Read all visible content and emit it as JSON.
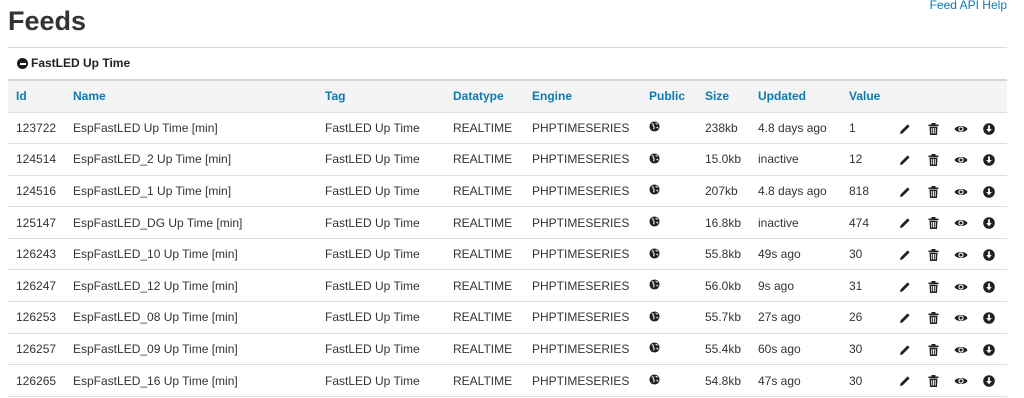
{
  "page": {
    "title": "Feeds",
    "api_help_link": "Feed API Help"
  },
  "group": {
    "title": "FastLED Up Time",
    "collapse_icon": "minus-circle-icon"
  },
  "table": {
    "columns": [
      "Id",
      "Name",
      "Tag",
      "Datatype",
      "Engine",
      "Public",
      "Size",
      "Updated",
      "Value"
    ],
    "action_icons": [
      "pencil-icon",
      "trash-icon",
      "eye-icon",
      "download-icon"
    ],
    "public_icon": "globe-icon",
    "status_colors": {
      "red": "#e52222",
      "orange": "#f0a020",
      "green": "#39a839"
    },
    "rows": [
      {
        "id": "123722",
        "name": "EspFastLED Up Time [min]",
        "tag": "FastLED Up Time",
        "datatype": "REALTIME",
        "engine": "PHPTIMESERIES",
        "size": "238kb",
        "updated": "4.8 days ago",
        "status": "red",
        "value": "1"
      },
      {
        "id": "124514",
        "name": "EspFastLED_2 Up Time [min]",
        "tag": "FastLED Up Time",
        "datatype": "REALTIME",
        "engine": "PHPTIMESERIES",
        "size": "15.0kb",
        "updated": "inactive",
        "status": "red",
        "value": "12"
      },
      {
        "id": "124516",
        "name": "EspFastLED_1 Up Time [min]",
        "tag": "FastLED Up Time",
        "datatype": "REALTIME",
        "engine": "PHPTIMESERIES",
        "size": "207kb",
        "updated": "4.8 days ago",
        "status": "red",
        "value": "818"
      },
      {
        "id": "125147",
        "name": "EspFastLED_DG Up Time [min]",
        "tag": "FastLED Up Time",
        "datatype": "REALTIME",
        "engine": "PHPTIMESERIES",
        "size": "16.8kb",
        "updated": "inactive",
        "status": "red",
        "value": "474"
      },
      {
        "id": "126243",
        "name": "EspFastLED_10 Up Time [min]",
        "tag": "FastLED Up Time",
        "datatype": "REALTIME",
        "engine": "PHPTIMESERIES",
        "size": "55.8kb",
        "updated": "49s ago",
        "status": "orange",
        "value": "30"
      },
      {
        "id": "126247",
        "name": "EspFastLED_12 Up Time [min]",
        "tag": "FastLED Up Time",
        "datatype": "REALTIME",
        "engine": "PHPTIMESERIES",
        "size": "56.0kb",
        "updated": "9s ago",
        "status": "green",
        "value": "31"
      },
      {
        "id": "126253",
        "name": "EspFastLED_08 Up Time [min]",
        "tag": "FastLED Up Time",
        "datatype": "REALTIME",
        "engine": "PHPTIMESERIES",
        "size": "55.7kb",
        "updated": "27s ago",
        "status": "orange",
        "value": "26"
      },
      {
        "id": "126257",
        "name": "EspFastLED_09 Up Time [min]",
        "tag": "FastLED Up Time",
        "datatype": "REALTIME",
        "engine": "PHPTIMESERIES",
        "size": "55.4kb",
        "updated": "60s ago",
        "status": "orange",
        "value": "30"
      },
      {
        "id": "126265",
        "name": "EspFastLED_16 Up Time [min]",
        "tag": "FastLED Up Time",
        "datatype": "REALTIME",
        "engine": "PHPTIMESERIES",
        "size": "54.8kb",
        "updated": "47s ago",
        "status": "orange",
        "value": "30"
      }
    ]
  }
}
